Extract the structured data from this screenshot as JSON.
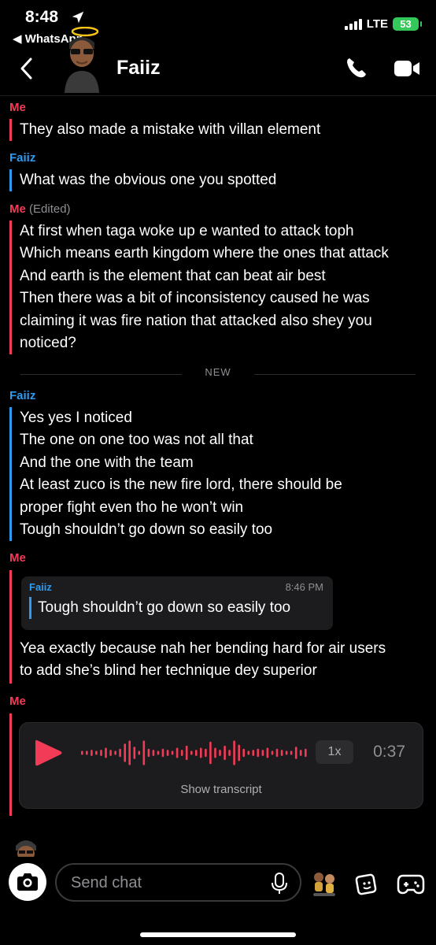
{
  "status_bar": {
    "time": "8:48",
    "back_app": "◀ WhatsApp",
    "network": "LTE",
    "battery": "53"
  },
  "header": {
    "contact_name": "Faiiz"
  },
  "messages": [
    {
      "sender": "Me",
      "edited": "",
      "lines": [
        "They also made a mistake with villan element"
      ]
    },
    {
      "sender": "Faiiz",
      "edited": "",
      "lines": [
        "What was the obvious one you spotted"
      ]
    },
    {
      "sender": "Me",
      "edited": "(Edited)",
      "lines": [
        "At first when taga woke up e wanted to attack toph",
        "Which means earth kingdom where the ones that attack",
        "And earth is the element that can beat air best",
        "Then there was a bit of inconsistency caused he was",
        "claiming it was fire nation that attacked also shey you",
        "noticed?"
      ]
    },
    {
      "sender": "Faiiz",
      "edited": "",
      "lines": [
        "Yes yes I noticed",
        "The one on one too was not all that",
        "And the one with the team",
        "At least zuco is the new fire lord, there should be",
        "proper fight even tho he won’t win",
        "Tough shouldn’t go down so easily too"
      ]
    },
    {
      "sender": "Me",
      "edited": "",
      "lines": [
        "Yea exactly because nah her bending hard for air users",
        "to add she’s blind her technique dey superior"
      ]
    },
    {
      "sender": "Me",
      "edited": "",
      "lines": []
    }
  ],
  "divider_label": "NEW",
  "quote": {
    "sender": "Faiiz",
    "time": "8:46 PM",
    "text": "Tough shouldn’t go down so easily too"
  },
  "voice_note": {
    "speed": "1x",
    "duration": "0:37",
    "transcript_label": "Show transcript"
  },
  "composer": {
    "placeholder": "Send chat"
  },
  "colors": {
    "me": "#f23c57",
    "friend": "#2e9bf0",
    "background": "#000000",
    "bubble": "#1c1c1e"
  },
  "icons": [
    "location-arrow-icon",
    "signal-icon",
    "battery-icon",
    "back-chevron-icon",
    "phone-icon",
    "video-camera-icon",
    "play-icon",
    "camera-icon",
    "microphone-icon",
    "sticker-icon",
    "game-controller-icon"
  ]
}
